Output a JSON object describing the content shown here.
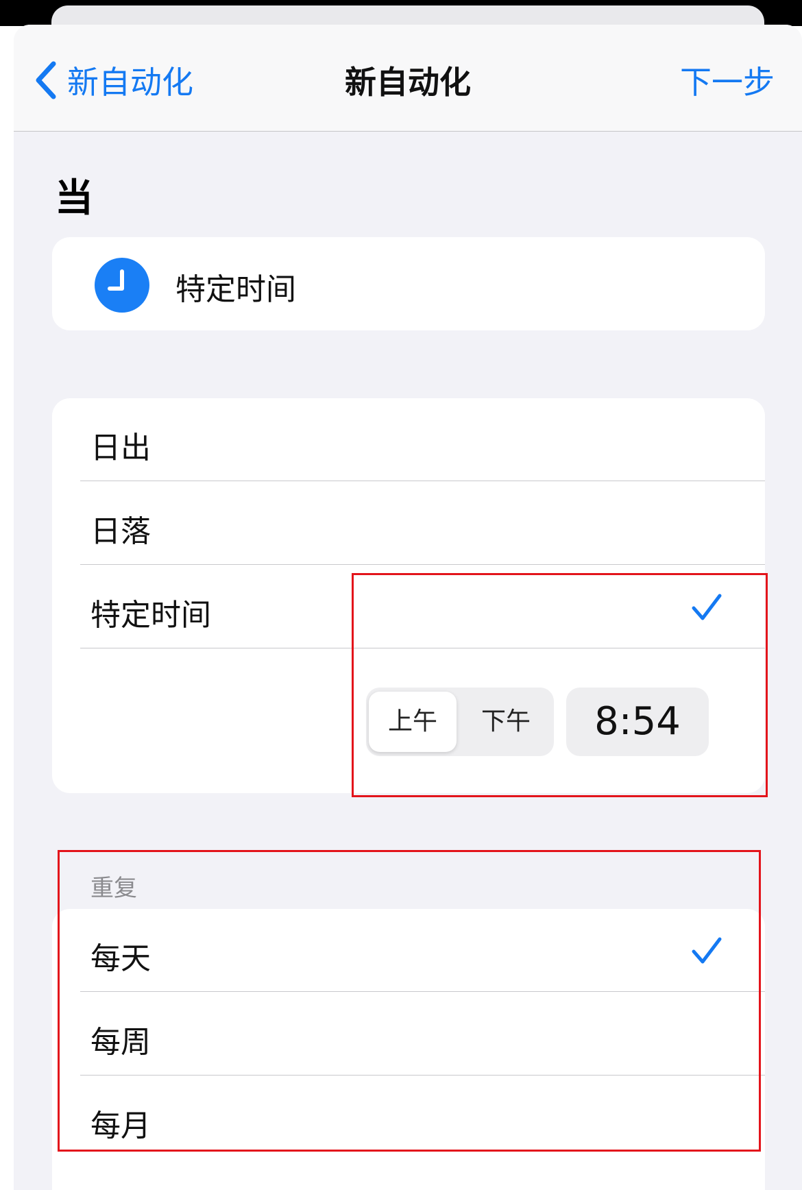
{
  "nav": {
    "back_label": "新自动化",
    "title": "新自动化",
    "next_label": "下一步"
  },
  "section_title": "当",
  "trigger": {
    "icon": "clock-icon",
    "label": "特定时间"
  },
  "time_options": [
    {
      "label": "日出",
      "selected": false
    },
    {
      "label": "日落",
      "selected": false
    },
    {
      "label": "特定时间",
      "selected": true
    }
  ],
  "time_picker": {
    "am_label": "上午",
    "pm_label": "下午",
    "selected_period": "上午",
    "time": "8:54"
  },
  "repeat": {
    "header": "重复",
    "options": [
      {
        "label": "每天",
        "selected": true
      },
      {
        "label": "每周",
        "selected": false
      },
      {
        "label": "每月",
        "selected": false
      }
    ]
  },
  "colors": {
    "accent": "#1479f2",
    "highlight_box": "#e3141b",
    "background": "#f2f2f7"
  }
}
